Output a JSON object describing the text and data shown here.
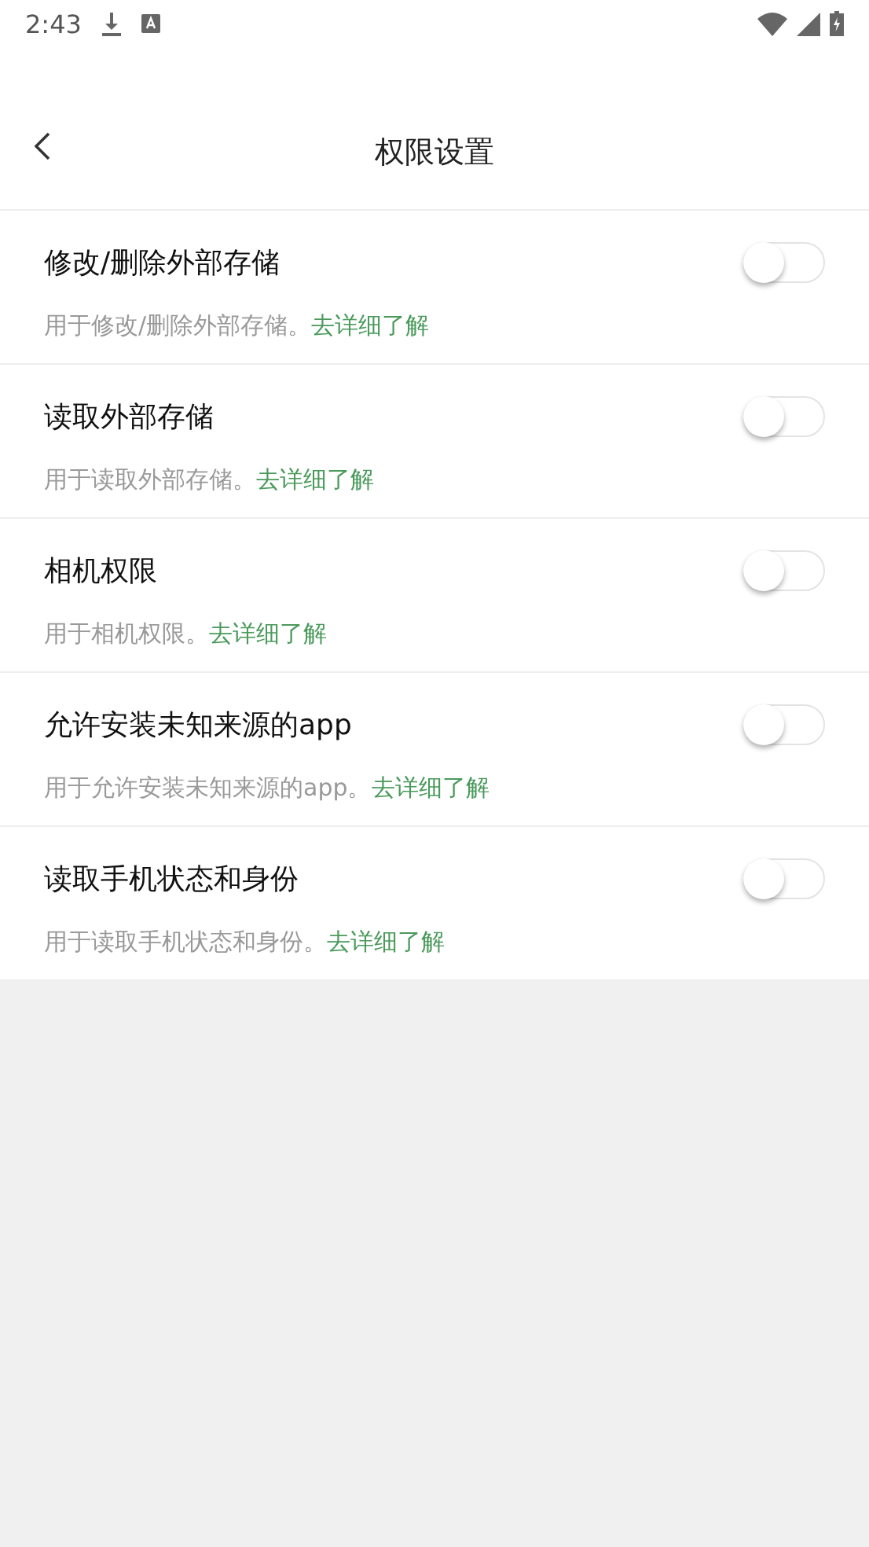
{
  "status_bar": {
    "time": "2:43"
  },
  "header": {
    "title": "权限设置"
  },
  "permissions": [
    {
      "title": "修改/删除外部存储",
      "description": "用于修改/删除外部存储。",
      "link": "去详细了解",
      "on": false
    },
    {
      "title": "读取外部存储",
      "description": "用于读取外部存储。",
      "link": "去详细了解",
      "on": false
    },
    {
      "title": "相机权限",
      "description": "用于相机权限。",
      "link": "去详细了解",
      "on": false
    },
    {
      "title": "允许安装未知来源的app",
      "description": "用于允许安装未知来源的app。",
      "link": "去详细了解",
      "on": false
    },
    {
      "title": "读取手机状态和身份",
      "description": "用于读取手机状态和身份。",
      "link": "去详细了解",
      "on": false
    }
  ]
}
